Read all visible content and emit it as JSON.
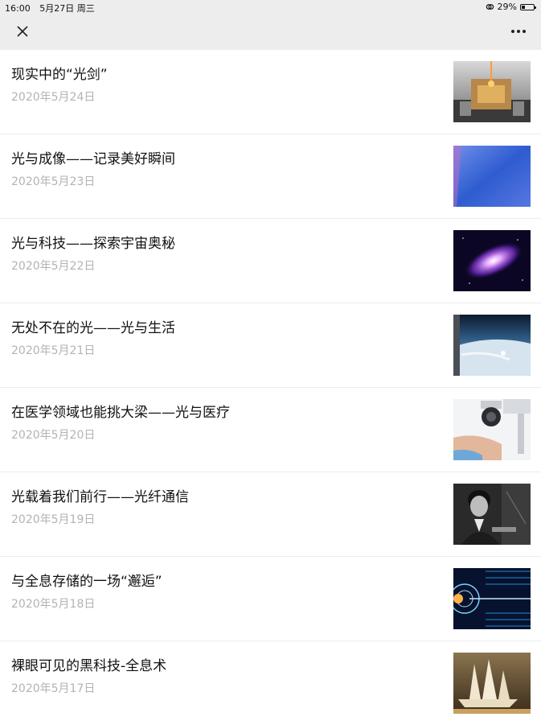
{
  "status_bar": {
    "time": "16:00",
    "date": "5月27日 周三",
    "battery": "29%"
  },
  "nav": {
    "close_icon": "close-icon",
    "more_icon": "more-icon"
  },
  "articles": [
    {
      "title": "现实中的“光剑”",
      "date": "2020年5月24日",
      "thumb": "laser-device"
    },
    {
      "title": "光与成像——记录美好瞬间",
      "date": "2020年5月23日",
      "thumb": "blue-gradient"
    },
    {
      "title": "光与科技——探索宇宙奥秘",
      "date": "2020年5月22日",
      "thumb": "galaxy"
    },
    {
      "title": "无处不在的光——光与生活",
      "date": "2020年5月21日",
      "thumb": "earth-from-space"
    },
    {
      "title": "在医学领域也能挑大梁——光与医疗",
      "date": "2020年5月20日",
      "thumb": "eye-exam"
    },
    {
      "title": "光载着我们前行——光纤通信",
      "date": "2020年5月19日",
      "thumb": "scientist-portrait"
    },
    {
      "title": "与全息存储的一场“邂逅”",
      "date": "2020年5月18日",
      "thumb": "data-storage"
    },
    {
      "title": "裸眼可见的黑科技-全息术",
      "date": "2020年5月17日",
      "thumb": "hologram-ship"
    }
  ]
}
